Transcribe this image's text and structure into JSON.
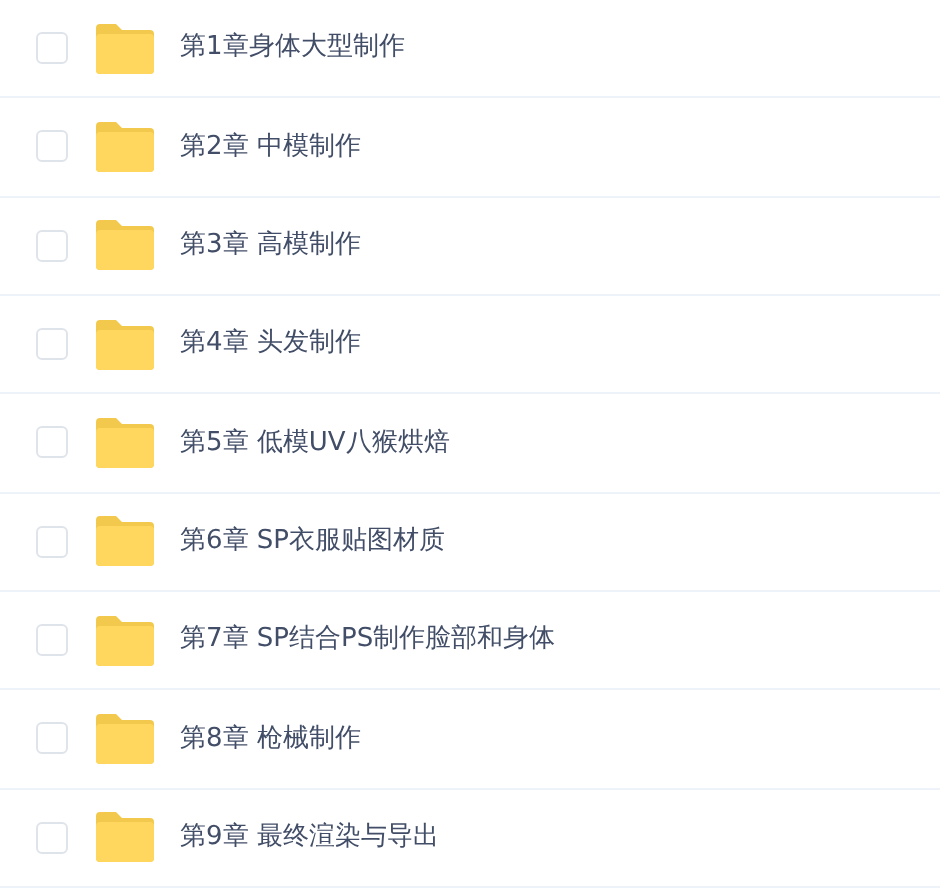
{
  "folders": [
    {
      "name": "第1章身体大型制作",
      "checked": false
    },
    {
      "name": "第2章 中模制作",
      "checked": false
    },
    {
      "name": "第3章 高模制作",
      "checked": false
    },
    {
      "name": "第4章 头发制作",
      "checked": false
    },
    {
      "name": "第5章 低模UV八猴烘焙",
      "checked": false
    },
    {
      "name": "第6章 SP衣服贴图材质",
      "checked": false
    },
    {
      "name": "第7章 SP结合PS制作脸部和身体",
      "checked": false
    },
    {
      "name": "第8章 枪械制作",
      "checked": false
    },
    {
      "name": "第9章 最终渲染与导出",
      "checked": false
    }
  ]
}
